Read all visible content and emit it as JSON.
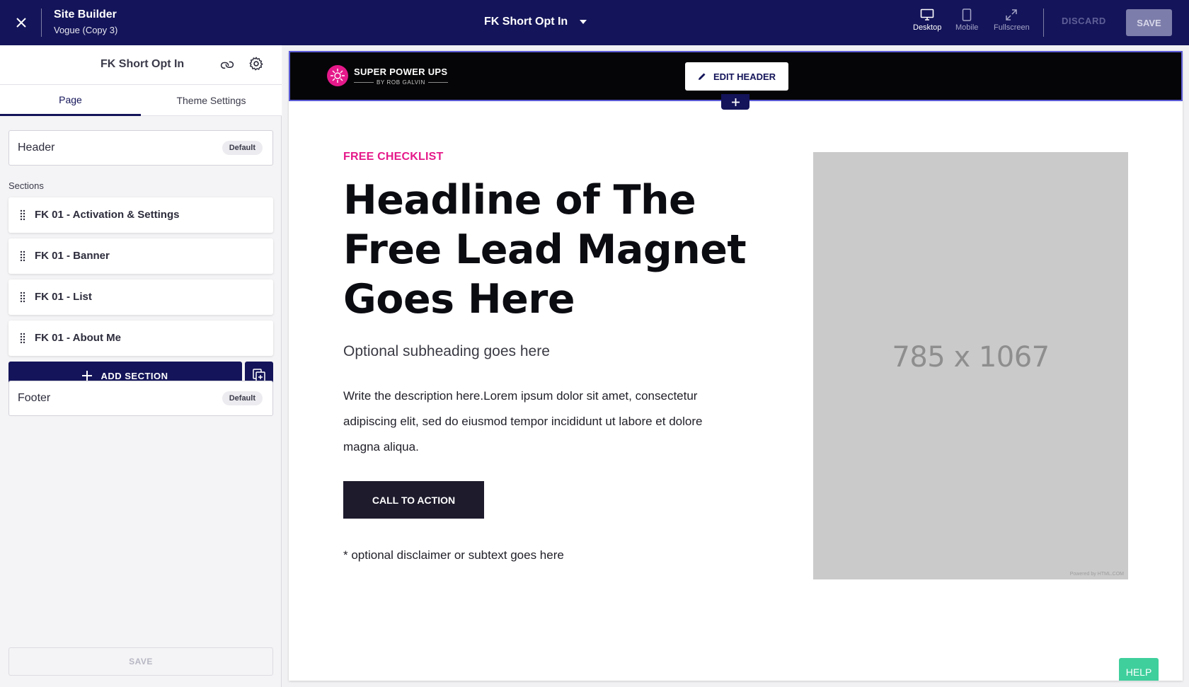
{
  "topbar": {
    "app_title": "Site Builder",
    "app_subtitle": "Vogue (Copy 3)",
    "page_selector": "FK Short Opt In",
    "views": {
      "desktop": "Desktop",
      "mobile": "Mobile",
      "fullscreen": "Fullscreen"
    },
    "active_view": "Desktop",
    "discard_label": "DISCARD",
    "save_label": "SAVE"
  },
  "sidebar": {
    "title": "FK Short Opt In",
    "tabs": [
      {
        "label": "Page",
        "active": true
      },
      {
        "label": "Theme Settings",
        "active": false
      }
    ],
    "header": {
      "label": "Header",
      "badge": "Default"
    },
    "sections_label": "Sections",
    "sections": [
      {
        "label": "FK 01 - Activation & Settings"
      },
      {
        "label": "FK 01 - Banner"
      },
      {
        "label": "FK 01 - List"
      },
      {
        "label": "FK 01 - About Me"
      }
    ],
    "add_section_label": "ADD SECTION",
    "footer": {
      "label": "Footer",
      "badge": "Default"
    },
    "save_label": "SAVE"
  },
  "canvas": {
    "logo": {
      "main": "SUPER POWER UPS",
      "sub": "BY ROB GALVIN"
    },
    "edit_header_label": "EDIT HEADER",
    "eyebrow": "FREE CHECKLIST",
    "headline": "Headline of The Free Lead Magnet Goes Here",
    "subheading": "Optional subheading goes here",
    "description": "Write the description here.Lorem ipsum dolor sit amet, consectetur adipiscing elit, sed do eiusmod tempor incididunt ut labore et dolore magna aliqua.",
    "cta_label": "CALL TO ACTION",
    "disclaimer": "* optional disclaimer or subtext goes here",
    "placeholder_text": "785 x 1067",
    "placeholder_credit": "Powered by HTML.COM"
  },
  "help_label": "HELP",
  "colors": {
    "topbar": "#14145a",
    "accent": "#14145a",
    "eyebrow": "#e5198a",
    "help": "#3fcf9c",
    "cta": "#1d1b2c"
  }
}
